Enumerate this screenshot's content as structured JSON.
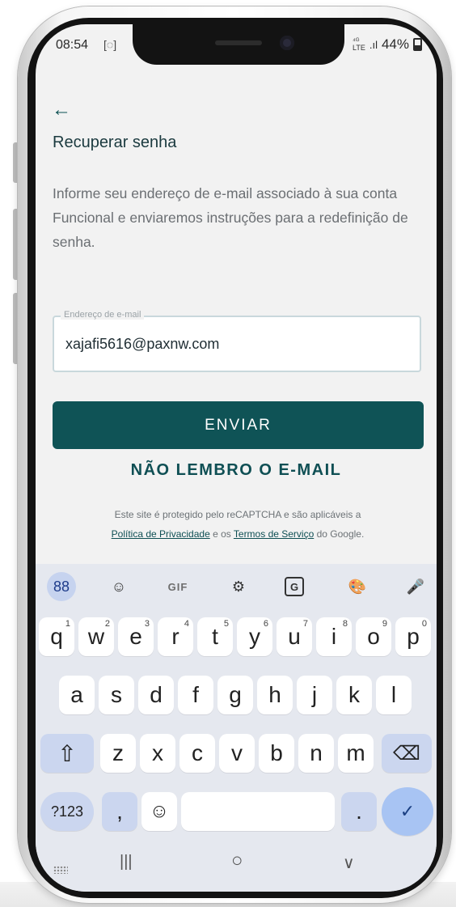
{
  "status_bar": {
    "time": "08:54",
    "cast_icon": "screen-cast-icon",
    "network_label": "LTE",
    "battery": "44%"
  },
  "page": {
    "back_icon": "←",
    "title": "Recuperar senha",
    "description": "Informe seu endereço de e-mail associado à sua conta Funcional e enviaremos instruções para a redefinição de senha."
  },
  "email_field": {
    "label": "Endereço de e-mail",
    "value": "xajafi5616@paxnw.com"
  },
  "buttons": {
    "submit": "ENVIAR",
    "forgot_email": "NÃO LEMBRO O E-MAIL"
  },
  "recaptcha": {
    "line1": "Este site é protegido pelo reCAPTCHA e são aplicáveis a",
    "privacy_link": "Política de Privacidade",
    "connector": " e os ",
    "terms_link": "Termos de Serviço",
    "suffix": " do Google."
  },
  "keyboard": {
    "toolbar": {
      "apps": "88",
      "sticker": "☺",
      "gif": "GIF",
      "settings": "⚙",
      "translate": "G",
      "theme": "🎨",
      "mic": "🎤"
    },
    "row1": [
      {
        "key": "q",
        "sup": "1"
      },
      {
        "key": "w",
        "sup": "2"
      },
      {
        "key": "e",
        "sup": "3"
      },
      {
        "key": "r",
        "sup": "4"
      },
      {
        "key": "t",
        "sup": "5"
      },
      {
        "key": "y",
        "sup": "6"
      },
      {
        "key": "u",
        "sup": "7"
      },
      {
        "key": "i",
        "sup": "8"
      },
      {
        "key": "o",
        "sup": "9"
      },
      {
        "key": "p",
        "sup": "0"
      }
    ],
    "row2": [
      "a",
      "s",
      "d",
      "f",
      "g",
      "h",
      "j",
      "k",
      "l"
    ],
    "row3": [
      "z",
      "x",
      "c",
      "v",
      "b",
      "n",
      "m"
    ],
    "shift": "⇧",
    "backspace": "⌫",
    "symbols": "?123",
    "comma": ",",
    "emoji": "☺",
    "period": ".",
    "enter": "✓"
  },
  "nav_bar": {
    "recent": "|||",
    "home": "○",
    "back": "∨"
  }
}
